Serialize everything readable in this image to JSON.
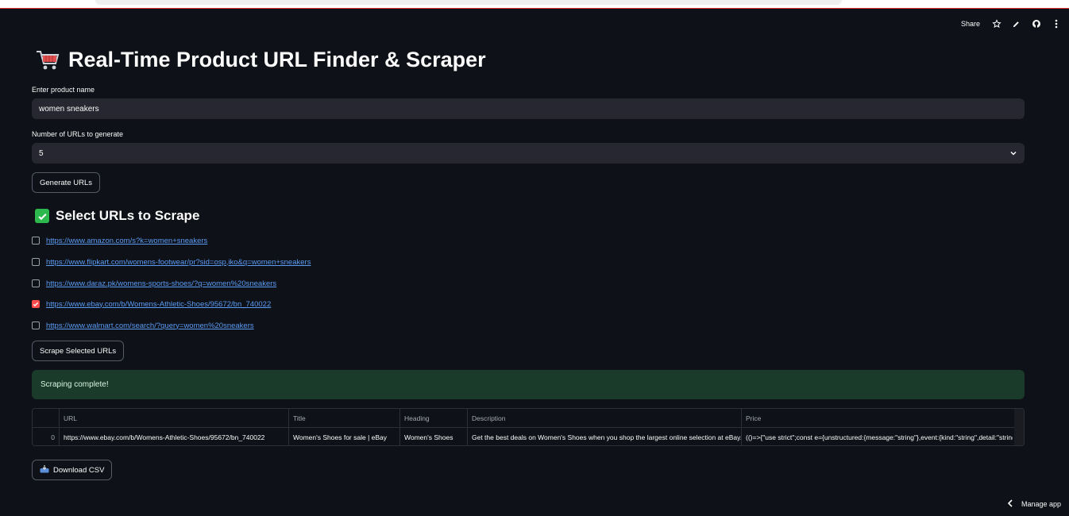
{
  "topbar": {
    "share_label": "Share"
  },
  "page": {
    "title": "Real-Time Product URL Finder & Scraper"
  },
  "form": {
    "product_label": "Enter product name",
    "product_value": "women sneakers",
    "count_label": "Number of URLs to generate",
    "count_value": "5",
    "generate_label": "Generate URLs"
  },
  "select_section": {
    "heading": "Select URLs to Scrape",
    "urls": [
      {
        "url": "https://www.amazon.com/s?k=women+sneakers",
        "checked": false
      },
      {
        "url": "https://www.flipkart.com/womens-footwear/pr?sid=osp,iko&q=women+sneakers",
        "checked": false
      },
      {
        "url": "https://www.daraz.pk/womens-sports-shoes/?q=women%20sneakers",
        "checked": false
      },
      {
        "url": "https://www.ebay.com/b/Womens-Athletic-Shoes/95672/bn_740022",
        "checked": true
      },
      {
        "url": "https://www.walmart.com/search/?query=women%20sneakers",
        "checked": false
      }
    ],
    "scrape_label": "Scrape Selected URLs"
  },
  "status": {
    "message": "Scraping complete!"
  },
  "table": {
    "columns": [
      "",
      "URL",
      "Title",
      "Heading",
      "Description",
      "Price"
    ],
    "rows": [
      {
        "index": "0",
        "url": "https://www.ebay.com/b/Womens-Athletic-Shoes/95672/bn_740022",
        "title": "Women's Shoes for sale | eBay",
        "heading": "Women's Shoes",
        "description": "Get the best deals on Women's Shoes when you shop the largest online selection at eBay.com.",
        "price": "(()=>{\"use strict\";const e={unstructured:{message:\"string\"},event:{kind:\"string\",detail:\"string\"}}"
      }
    ]
  },
  "download": {
    "label": "Download CSV"
  },
  "footer": {
    "manage_label": "Manage app"
  },
  "colors": {
    "background": "#0e1117",
    "input": "#262730",
    "accent": "#ff4b4b",
    "link": "#5b9cf5",
    "success_bg": "#1a3a2a"
  }
}
